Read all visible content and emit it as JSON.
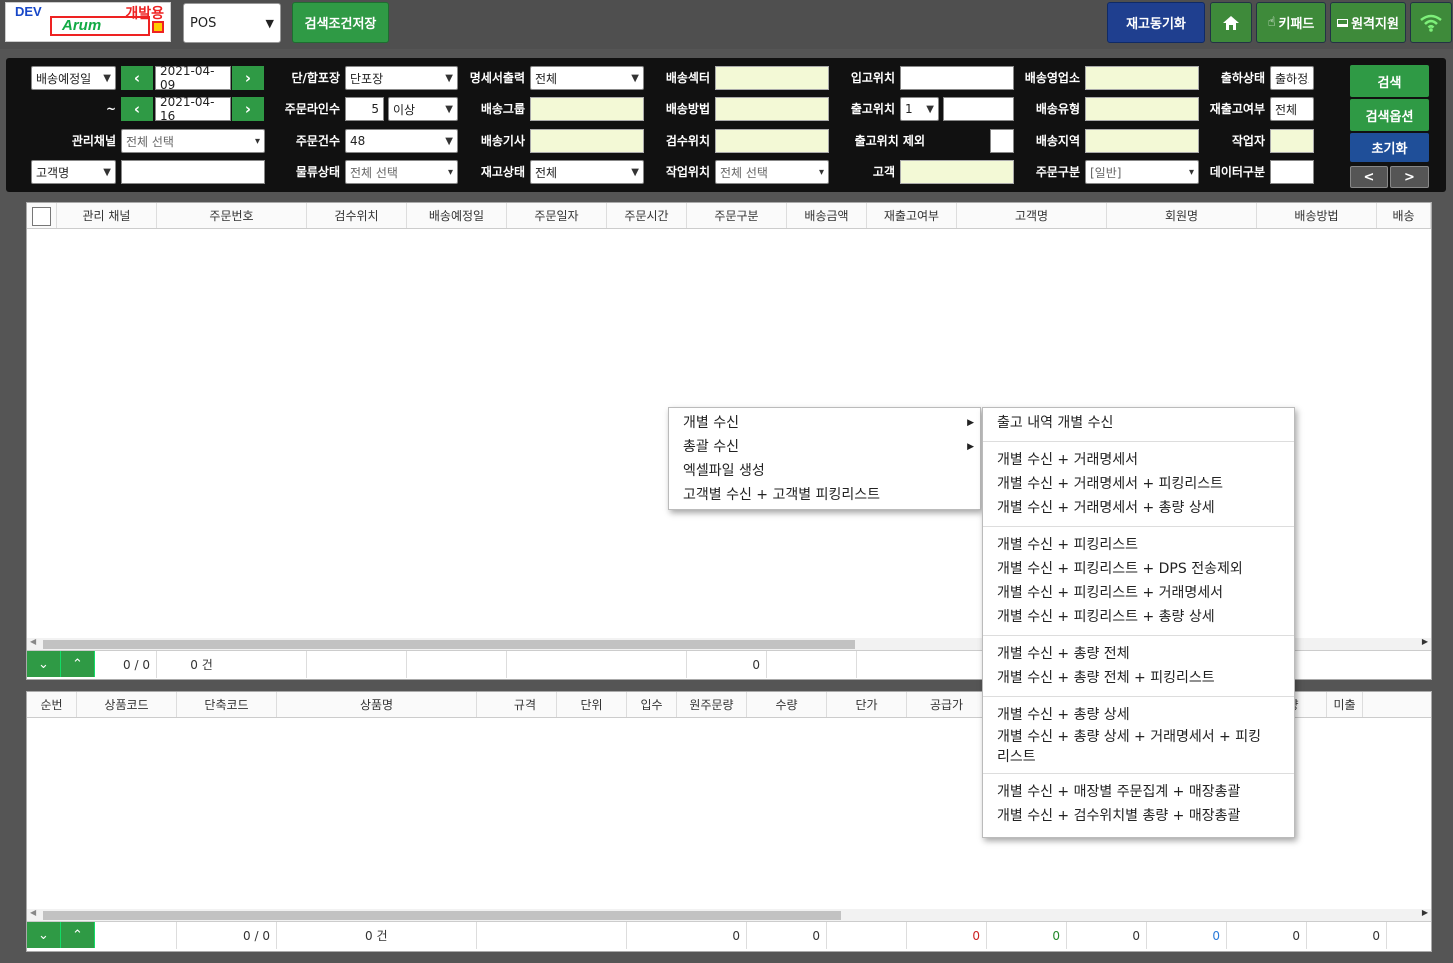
{
  "topbar": {
    "logo_dev": "DEV",
    "logo_brand": "Arum",
    "logo_kaebal": "개발용",
    "pos_select": "POS",
    "save_search_label": "검색조건저장",
    "stock_sync_label": "재고동기화",
    "keypad_label": "키패드",
    "remote_label": "원격지원"
  },
  "search": {
    "date_type": "배송예정일",
    "date_from": "2021-04-09",
    "tilde": "~",
    "date_to": "2021-04-16",
    "channel_label": "관리채널",
    "channel_value": "전체 선택",
    "customer_type": "고객명",
    "customer_value": "",
    "pack_label": "단/합포장",
    "pack_value": "단포장",
    "qty_label": "주문라인수",
    "qty_value": "5",
    "qty_op": "이상",
    "order_count_label": "주문건수",
    "order_count_value": "48",
    "logistics_label": "물류상태",
    "logistics_value": "전체 선택",
    "statement_label": "명세서출력",
    "statement_value": "전체",
    "ship_group_label": "배송그룹",
    "driver_label": "배송기사",
    "stock_status_label": "재고상태",
    "stock_status_value": "전체",
    "center_label": "배송섹터",
    "method_label": "배송방법",
    "inspect_loc_label": "검수위치",
    "work_loc_label": "작업위치",
    "work_loc_value": "전체 선택",
    "in_loc_label": "입고위치",
    "out_loc_label": "출고위치",
    "out_loc_value": "1",
    "out_excl_label": "출고위치 제외",
    "customer_label": "고객",
    "office_label": "배송영업소",
    "ship_type_label": "배송유형",
    "region_label": "배송지역",
    "order_type_label": "주문구분",
    "order_type_value": "[일반]",
    "ship_status_label": "출하상태",
    "ship_status_value": "출하정소",
    "reship_label": "재출고여부",
    "reship_value": "전체",
    "worker_label": "작업자",
    "data_type_label": "데이터구분",
    "search_btn": "검색",
    "option_btn": "검색옵션",
    "reset_btn": "초기화",
    "prev_btn": "<",
    "next_btn": ">"
  },
  "grid1": {
    "headers": [
      "관리 채널",
      "주문번호",
      "검수위치",
      "배송예정일",
      "주문일자",
      "주문시간",
      "주문구분",
      "배송금액",
      "재출고여부",
      "고객명",
      "회원명",
      "배송방법",
      "배송"
    ],
    "footer": {
      "pages": "0 / 0",
      "count": "0 건",
      "amount": "0"
    }
  },
  "grid2": {
    "headers": [
      "순번",
      "상품코드",
      "단축코드",
      "상품명",
      "규격",
      "단위",
      "입수",
      "원주문량",
      "수량",
      "단가",
      "공급가",
      "",
      "",
      "",
      "미출잔량",
      "미출"
    ],
    "footer": {
      "pages": "0 / 0",
      "count": "0 건",
      "v1": "0",
      "v2": "0",
      "v3": "0",
      "v4": "0",
      "v5": "0",
      "v6": "0",
      "v7": "0",
      "v8": "0"
    },
    "colors": {
      "red": "#cc2222",
      "green": "#22882a",
      "blue": "#2a7ad8"
    }
  },
  "menu": {
    "items": [
      "개별 수신",
      "총괄 수신",
      "엑셀파일 생성",
      "고객별 수신 + 고객별 피킹리스트"
    ],
    "sub": [
      "출고 내역 개별 수신",
      "개별 수신 + 거래명세서",
      "개별 수신 + 거래명세서 + 피킹리스트",
      "개별 수신 + 거래명세서 + 총량 상세",
      "개별 수신 + 피킹리스트",
      "개별 수신 + 피킹리스트 + DPS 전송제외",
      "개별 수신 + 피킹리스트 + 거래명세서",
      "개별 수신 + 피킹리스트 + 총량 상세",
      "개별 수신 + 총량 전체",
      "개별 수신 + 총량 전체 + 피킹리스트",
      "개별 수신 + 총량 상세",
      "개별 수신 + 총량 상세 + 거래명세서 + 피킹",
      "리스트",
      "개별 수신 + 매장별 주문집계 + 매장총괄",
      "개별 수신 + 검수위치별 총량 + 매장총괄"
    ]
  }
}
